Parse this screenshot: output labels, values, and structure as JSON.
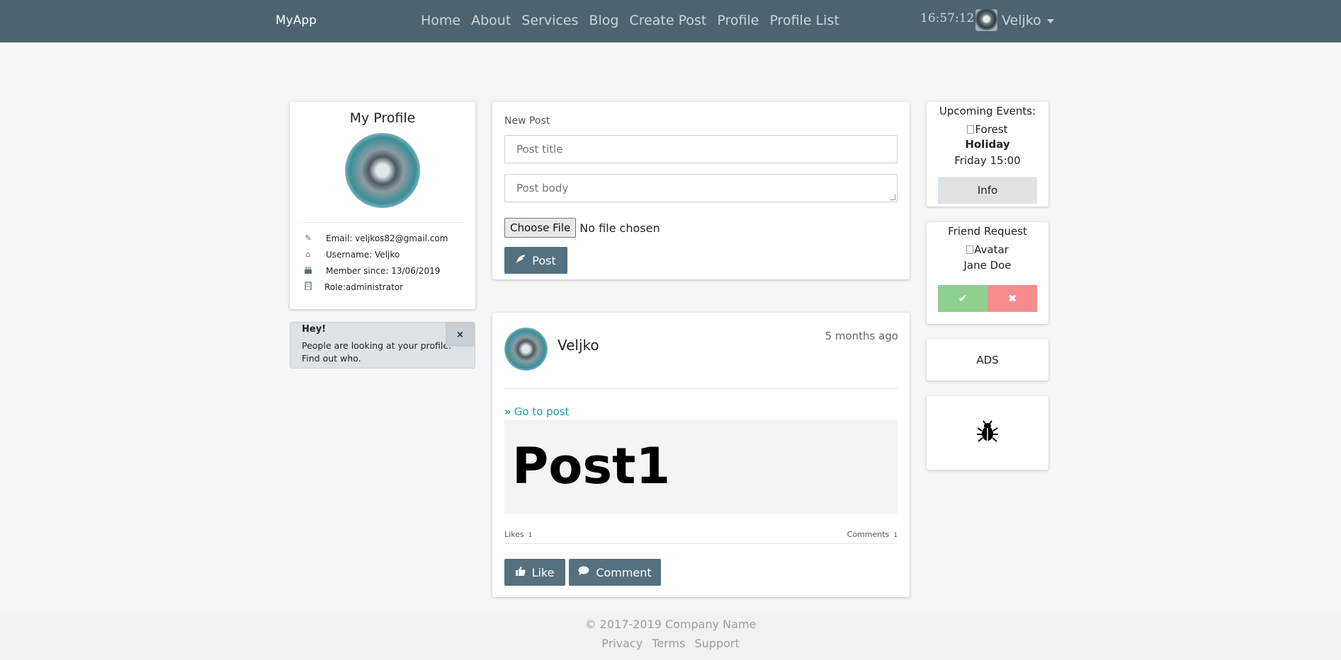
{
  "navbar": {
    "brand": "MyApp",
    "links": [
      "Home",
      "About",
      "Services",
      "Blog",
      "Create Post",
      "Profile",
      "Profile List"
    ],
    "clock": "16:57:12",
    "user": "Veljko"
  },
  "profile": {
    "title": "My Profile",
    "email": "Email: veljkos82@gmail.com",
    "username": "Username: Veljko",
    "member_since": "Member since: 13/06/2019",
    "role": "Role:administrator"
  },
  "alert": {
    "heading": "Hey!",
    "text": "People are looking at your profile. Find out who.",
    "close": "×"
  },
  "new_post": {
    "label": "New Post",
    "title_placeholder": "Post title",
    "body_placeholder": "Post body",
    "file_button": "Choose File",
    "file_status": "No file chosen",
    "submit": "Post"
  },
  "post": {
    "author": "Veljko",
    "time_ago": "5 months ago",
    "go_to_post": "Go to post",
    "body": "Post1",
    "likes_label": "Likes",
    "likes_count": "1",
    "comments_label": "Comments",
    "comments_count": "1",
    "like_button": "Like",
    "comment_button": "Comment"
  },
  "events": {
    "title": "Upcoming Events:",
    "image_alt": "Forest",
    "name": "Holiday",
    "when": "Friday 15:00",
    "info_button": "Info"
  },
  "friend_request": {
    "title": "Friend Request",
    "image_alt": "Avatar",
    "name": "Jane Doe",
    "accept": "✔",
    "reject": "✖"
  },
  "ads": {
    "label": "ADS"
  },
  "footer": {
    "copyright": "© 2017-2019 Company Name",
    "links": [
      "Privacy",
      "Terms",
      "Support"
    ]
  }
}
